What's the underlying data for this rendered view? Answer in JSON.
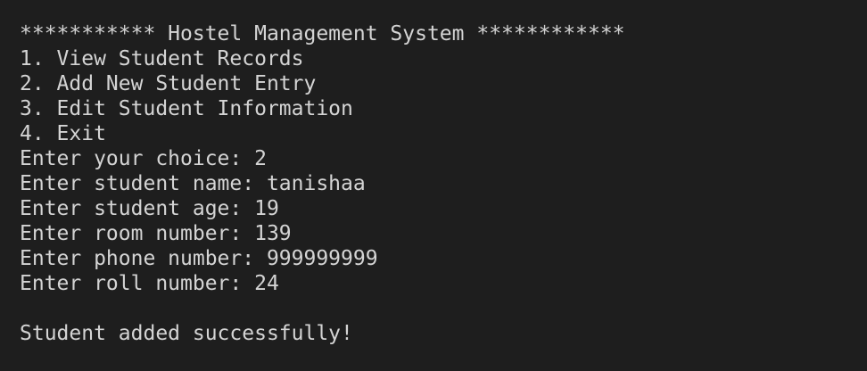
{
  "terminal": {
    "colors": {
      "background": "#1e1e1e",
      "foreground": "#d4d4d4"
    },
    "lines": [
      "*********** Hostel Management System ************",
      "1. View Student Records",
      "2. Add New Student Entry",
      "3. Edit Student Information",
      "4. Exit",
      "Enter your choice: 2",
      "Enter student name: tanishaa",
      "Enter student age: 19",
      "Enter room number: 139",
      "Enter phone number: 999999999",
      "Enter roll number: 24",
      "",
      "Student added successfully!"
    ]
  }
}
